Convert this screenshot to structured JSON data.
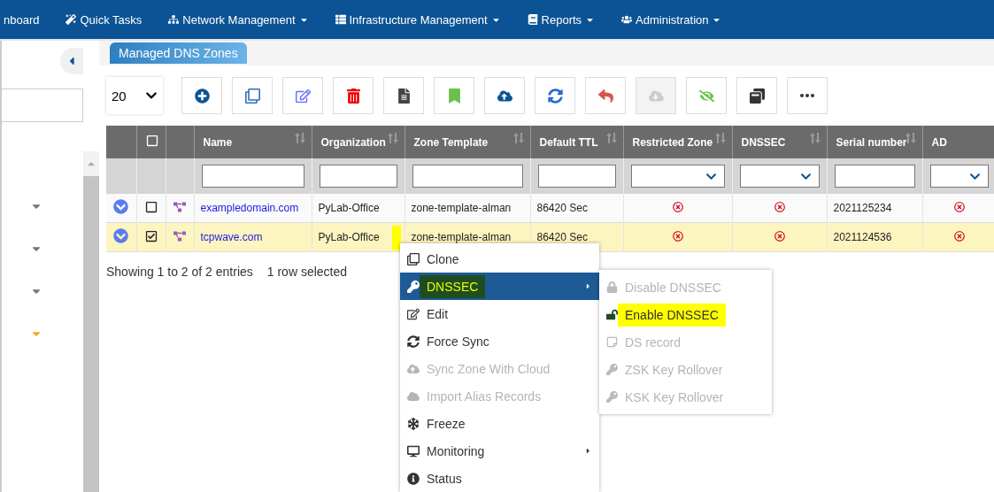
{
  "nav": {
    "items": [
      {
        "label": "nboard",
        "dropdown": false
      },
      {
        "label": "Quick Tasks",
        "dropdown": false
      },
      {
        "label": "Network Management",
        "dropdown": true
      },
      {
        "label": "Infrastructure Management",
        "dropdown": true
      },
      {
        "label": "Reports",
        "dropdown": true
      },
      {
        "label": "Administration",
        "dropdown": true
      }
    ]
  },
  "sidebar": {
    "items": [
      {
        "color": "#777777"
      },
      {
        "color": "#777777"
      },
      {
        "color": "#777777"
      },
      {
        "color": "#f5a623"
      }
    ]
  },
  "page_title": "Managed DNS Zones",
  "toolbar": {
    "page_size": "20",
    "buttons": [
      {
        "disabled": false
      },
      {
        "disabled": false
      },
      {
        "disabled": false
      },
      {
        "disabled": false
      },
      {
        "disabled": false
      },
      {
        "disabled": false
      },
      {
        "disabled": false
      },
      {
        "disabled": false
      },
      {
        "disabled": false
      },
      {
        "disabled": true
      },
      {
        "disabled": false
      },
      {
        "disabled": false
      },
      {
        "disabled": false
      }
    ]
  },
  "table": {
    "select_all": false,
    "columns": [
      {
        "label": "Name",
        "sortable": true,
        "kind": "text"
      },
      {
        "label": "Organization",
        "sortable": true,
        "kind": "text"
      },
      {
        "label": "Zone Template",
        "sortable": true,
        "kind": "text"
      },
      {
        "label": "Default TTL",
        "sortable": true,
        "kind": "text"
      },
      {
        "label": "Restricted Zone",
        "sortable": true,
        "kind": "select"
      },
      {
        "label": "DNSSEC",
        "sortable": true,
        "kind": "select"
      },
      {
        "label": "Serial number",
        "sortable": true,
        "kind": "text"
      },
      {
        "label": "AD",
        "sortable": false,
        "kind": "select"
      }
    ],
    "rows": [
      {
        "selected": false,
        "checked": false,
        "name": "exampledomain.com",
        "organization": "PyLab-Office",
        "zone_template": "zone-template-alman",
        "default_ttl": "86420 Sec",
        "restricted_zone": false,
        "dnssec": false,
        "serial_number": "2021125234",
        "ad": false,
        "marked": false
      },
      {
        "selected": true,
        "checked": true,
        "name": "tcpwave.com",
        "organization": "PyLab-Office",
        "zone_template": "zone-template-alman",
        "default_ttl": "86420 Sec",
        "restricted_zone": false,
        "dnssec": false,
        "serial_number": "2021124536",
        "ad": false,
        "marked": true
      }
    ]
  },
  "footer": {
    "entries": "Showing 1 to 2 of 2 entries",
    "selection": "1 row selected"
  },
  "context_menu": {
    "items": [
      {
        "label": "Clone",
        "disabled": false,
        "submenu": false,
        "active": false,
        "highlighted": false
      },
      {
        "label": "DNSSEC",
        "disabled": false,
        "submenu": true,
        "active": true,
        "highlighted": true
      },
      {
        "label": "Edit",
        "disabled": false,
        "submenu": false,
        "active": false,
        "highlighted": false
      },
      {
        "label": "Force Sync",
        "disabled": false,
        "submenu": false,
        "active": false,
        "highlighted": false
      },
      {
        "label": "Sync Zone With Cloud",
        "disabled": true,
        "submenu": false,
        "active": false,
        "highlighted": false
      },
      {
        "label": "Import Alias Records",
        "disabled": true,
        "submenu": false,
        "active": false,
        "highlighted": false
      },
      {
        "label": "Freeze",
        "disabled": false,
        "submenu": false,
        "active": false,
        "highlighted": false
      },
      {
        "label": "Monitoring",
        "disabled": false,
        "submenu": true,
        "active": false,
        "highlighted": false
      },
      {
        "label": "Status",
        "disabled": false,
        "submenu": false,
        "active": false,
        "highlighted": false
      }
    ]
  },
  "submenu": {
    "items": [
      {
        "label": "Disable DNSSEC",
        "disabled": true,
        "highlighted": false
      },
      {
        "label": "Enable DNSSEC",
        "disabled": false,
        "highlighted": true
      },
      {
        "label": "DS record",
        "disabled": true,
        "highlighted": false
      },
      {
        "label": "ZSK Key Rollover",
        "disabled": true,
        "highlighted": false
      },
      {
        "label": "KSK Key Rollover",
        "disabled": true,
        "highlighted": false
      }
    ]
  }
}
